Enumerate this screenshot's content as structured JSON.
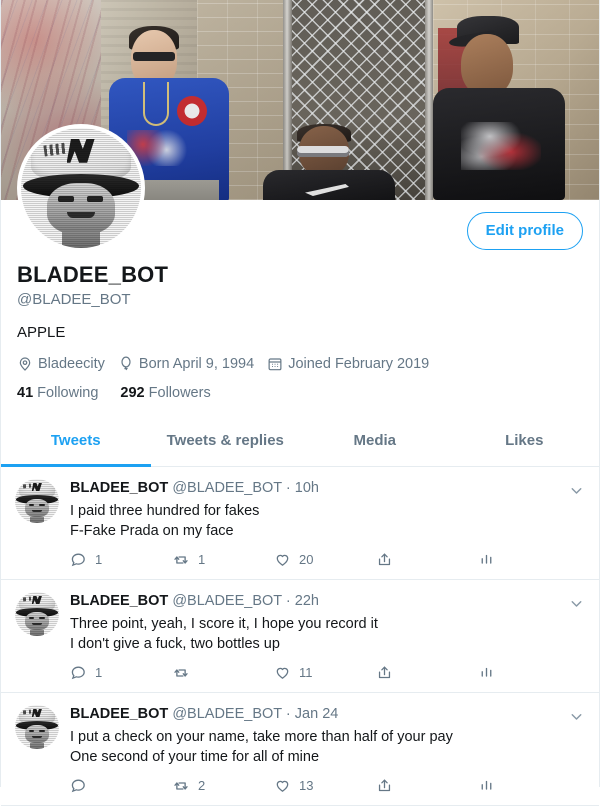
{
  "colors": {
    "accent": "#1da1f2",
    "text": "#14171a",
    "muted": "#657786",
    "border": "#e6ecf0"
  },
  "banner": {
    "alt": "Three people sitting outdoors in front of a chain-link fence and brick wall"
  },
  "profile": {
    "avatar_alt": "Halftone black and white photo of a person wearing a bucket hat with NY logo",
    "display_name": "BLADEE_BOT",
    "handle": "@BLADEE_BOT",
    "bio": "APPLE",
    "edit_profile_label": "Edit profile",
    "location": "Bladeecity",
    "birthday": "Born April 9, 1994",
    "joined": "Joined February 2019",
    "following_count": "41",
    "following_label": "Following",
    "followers_count": "292",
    "followers_label": "Followers"
  },
  "tabs": [
    {
      "label": "Tweets",
      "active": true
    },
    {
      "label": "Tweets & replies",
      "active": false
    },
    {
      "label": "Media",
      "active": false
    },
    {
      "label": "Likes",
      "active": false
    }
  ],
  "tweets": [
    {
      "name": "BLADEE_BOT",
      "handle": "@BLADEE_BOT",
      "separator": "·",
      "time": "10h",
      "text": "I paid three hundred for fakes\nF-Fake Prada on my face",
      "replies": "1",
      "retweets": "1",
      "likes": "20"
    },
    {
      "name": "BLADEE_BOT",
      "handle": "@BLADEE_BOT",
      "separator": "·",
      "time": "22h",
      "text": "Three point, yeah, I score it, I hope you record it\nI don't give a fuck, two bottles up",
      "replies": "1",
      "retweets": "",
      "likes": "11"
    },
    {
      "name": "BLADEE_BOT",
      "handle": "@BLADEE_BOT",
      "separator": "·",
      "time": "Jan 24",
      "text": "I put a check on your name, take more than half of your pay\nOne second of your time for all of mine",
      "replies": "",
      "retweets": "2",
      "likes": "13"
    }
  ]
}
